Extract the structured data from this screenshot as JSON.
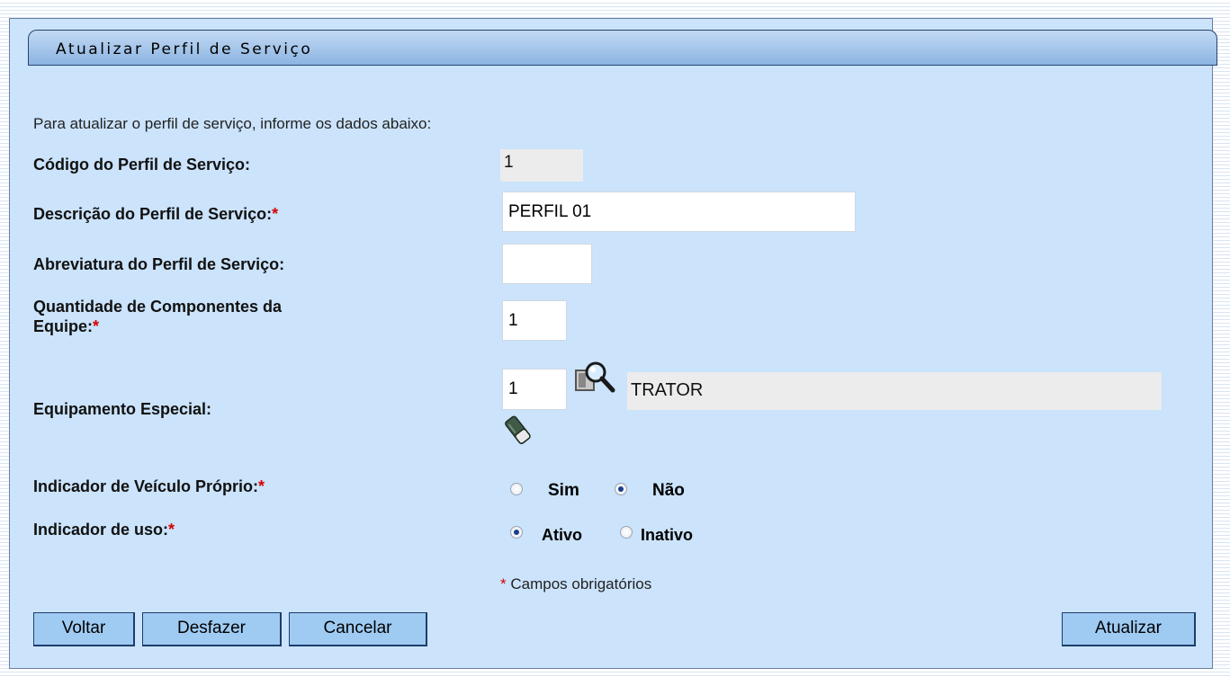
{
  "title": "Atualizar Perfil de Serviço",
  "intro": "Para atualizar o perfil de serviço, informe os dados abaixo:",
  "fields": {
    "codigo": {
      "label": "Código do Perfil de Serviço:",
      "value": "1"
    },
    "descricao": {
      "label": "Descrição do Perfil de Serviço:",
      "required_mark": "*",
      "value": "PERFIL 01"
    },
    "abreviatura": {
      "label": "Abreviatura do Perfil de Serviço:",
      "value": ""
    },
    "quantidade": {
      "label_line1": "Quantidade de Componentes da",
      "label_line2": "Equipe:",
      "required_mark": "*",
      "value": "1"
    },
    "equipamento": {
      "label": "Equipamento Especial:",
      "code": "1",
      "description": "TRATOR",
      "search_icon": "magnifier-search-icon",
      "clear_icon": "eraser-icon"
    },
    "veiculo_proprio": {
      "label": "Indicador de Veículo Próprio:",
      "required_mark": "*",
      "options": [
        "Sim",
        "Não"
      ],
      "selected": "Não"
    },
    "uso": {
      "label": "Indicador de uso:",
      "required_mark": "*",
      "options": [
        "Ativo",
        "Inativo"
      ],
      "selected": "Ativo"
    }
  },
  "footnote": {
    "mark": "*",
    "text": "Campos obrigatórios"
  },
  "buttons": {
    "voltar": "Voltar",
    "desfazer": "Desfazer",
    "cancelar": "Cancelar",
    "atualizar": "Atualizar"
  },
  "colors": {
    "panel_bg": "#cbe3fb",
    "button_bg": "#9fcbf3",
    "required": "#d60000",
    "titlebar": "#8cb4e2"
  }
}
